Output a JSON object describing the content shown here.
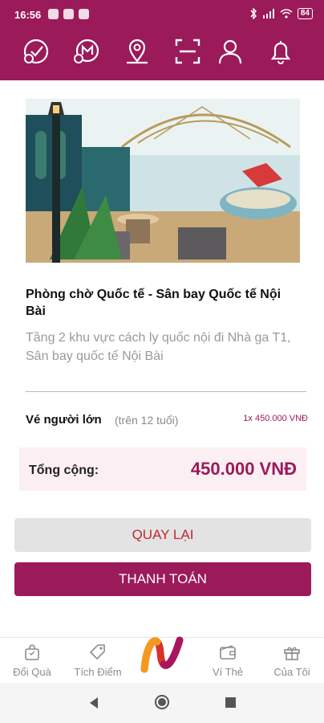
{
  "status": {
    "time": "16:56",
    "battery": "84"
  },
  "top_icons": [
    "checkin-icon",
    "miles-icon",
    "location-icon",
    "scan-icon",
    "user-icon",
    "bell-icon"
  ],
  "lounge": {
    "title": "Phòng chờ Quốc tế - Sân bay Quốc tế Nội Bài",
    "address": "Tầng 2 khu vực cách ly quốc nội đi Nhà ga T1, Sân bay quốc tế Nội Bài"
  },
  "ticket": {
    "label": "Vé người lớn",
    "note": "(trên 12 tuổi)",
    "price": "1x 450.000 VNĐ"
  },
  "total": {
    "label": "Tổng cộng:",
    "value": "450.000 VNĐ"
  },
  "buttons": {
    "back": "QUAY LẠI",
    "pay": "THANH TOÁN"
  },
  "bottom_nav": {
    "redeem": "Đổi Quà",
    "earn": "Tích Điểm",
    "wallet": "Ví Thẻ",
    "mine": "Của Tôi"
  },
  "colors": {
    "brand": "#9b1a5a",
    "back_text": "#c0282f"
  }
}
